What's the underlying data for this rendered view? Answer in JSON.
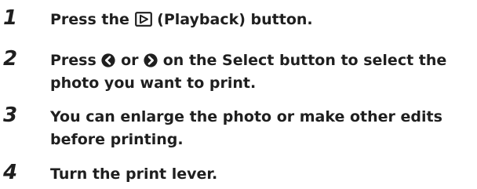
{
  "steps": [
    {
      "number": "1",
      "text_before": "Press the",
      "icon": "playback-icon",
      "text_after": "(Playback) button."
    },
    {
      "number": "2",
      "text_before": "Press",
      "icon_left": "left-arrow-icon",
      "text_or": "or",
      "icon_right": "right-arrow-icon",
      "text_after_line1": "on the Select button to select the",
      "text_line2": "photo you want to print."
    },
    {
      "number": "3",
      "text_line1": "You can enlarge the photo or make other edits",
      "text_line2": "before printing."
    },
    {
      "number": "4",
      "text_line1": "Turn the print lever."
    }
  ]
}
